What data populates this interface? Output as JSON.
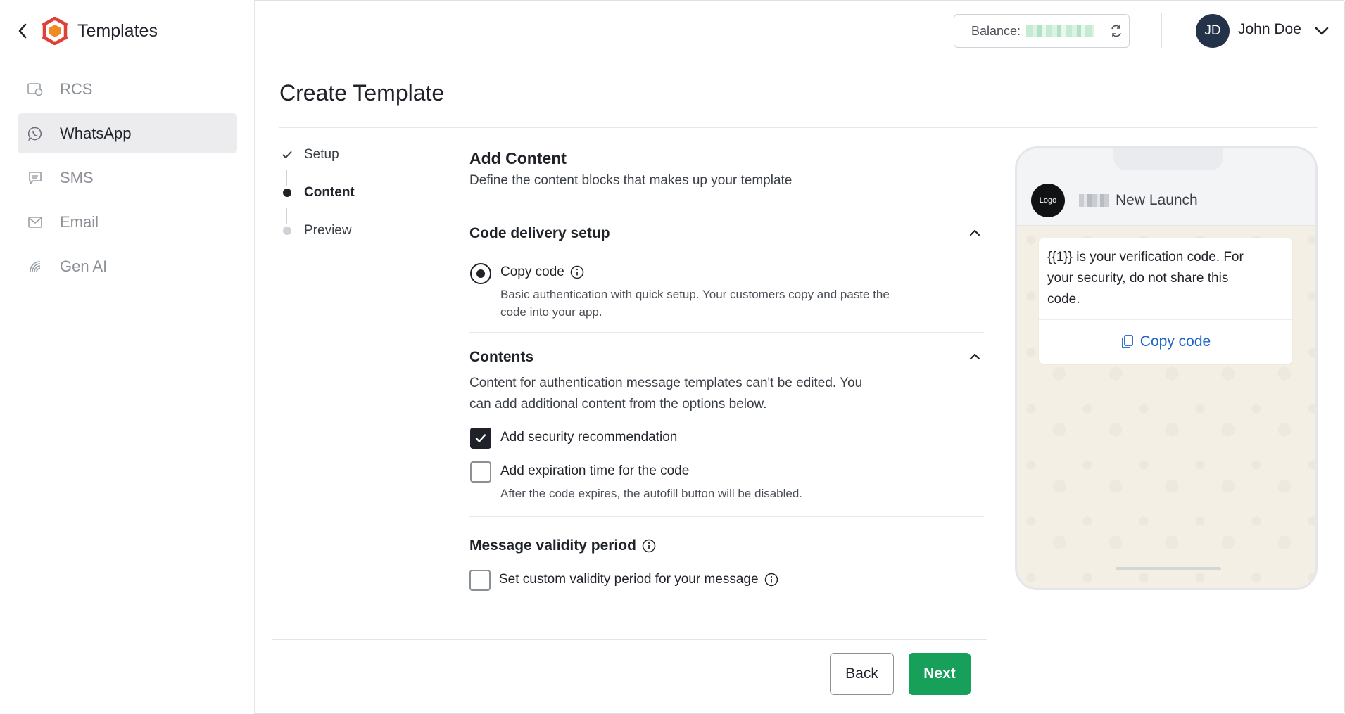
{
  "sidebar": {
    "title": "Templates",
    "items": [
      {
        "label": "RCS",
        "icon": "rcs-icon"
      },
      {
        "label": "WhatsApp",
        "icon": "whatsapp-icon",
        "active": true
      },
      {
        "label": "SMS",
        "icon": "sms-icon"
      },
      {
        "label": "Email",
        "icon": "email-icon"
      },
      {
        "label": "Gen AI",
        "icon": "gen-ai-icon"
      }
    ]
  },
  "header": {
    "balance_label": "Balance:",
    "user": {
      "initials": "JD",
      "name": "John Doe"
    }
  },
  "page": {
    "title": "Create Template"
  },
  "steps": [
    {
      "label": "Setup",
      "state": "done"
    },
    {
      "label": "Content",
      "state": "current"
    },
    {
      "label": "Preview",
      "state": "pending"
    }
  ],
  "content": {
    "title": "Add Content",
    "subtitle": "Define the content blocks that makes up your template",
    "code_delivery": {
      "title": "Code delivery setup",
      "option_label": "Copy code",
      "option_desc_1": "Basic authentication with quick setup. Your customers copy and paste the",
      "option_desc_2": "code into your app."
    },
    "contents": {
      "title": "Contents",
      "desc_1": "Content for authentication message templates can't be edited. You",
      "desc_2": "can add additional content from the options below.",
      "security_label": "Add security recommendation",
      "expiration_label": "Add expiration time for the code",
      "expiration_desc": "After the code expires, the autofill button will be disabled."
    },
    "validity": {
      "title": "Message validity period",
      "checkbox_label": "Set custom validity period for your message"
    }
  },
  "footer": {
    "back_label": "Back",
    "next_label": "Next"
  },
  "preview": {
    "logo_text": "Logo",
    "chat_name": "New Launch",
    "message_1": "{{1}} is your verification code. For",
    "message_2": "your security, do not share this",
    "message_3": "code.",
    "button_label": "Copy code"
  },
  "colors": {
    "primary_button": "#17a05a",
    "link_blue": "#1d63c9",
    "avatar_bg": "#243349",
    "brand_red": "#e0403a",
    "brand_orange": "#f08a24"
  }
}
